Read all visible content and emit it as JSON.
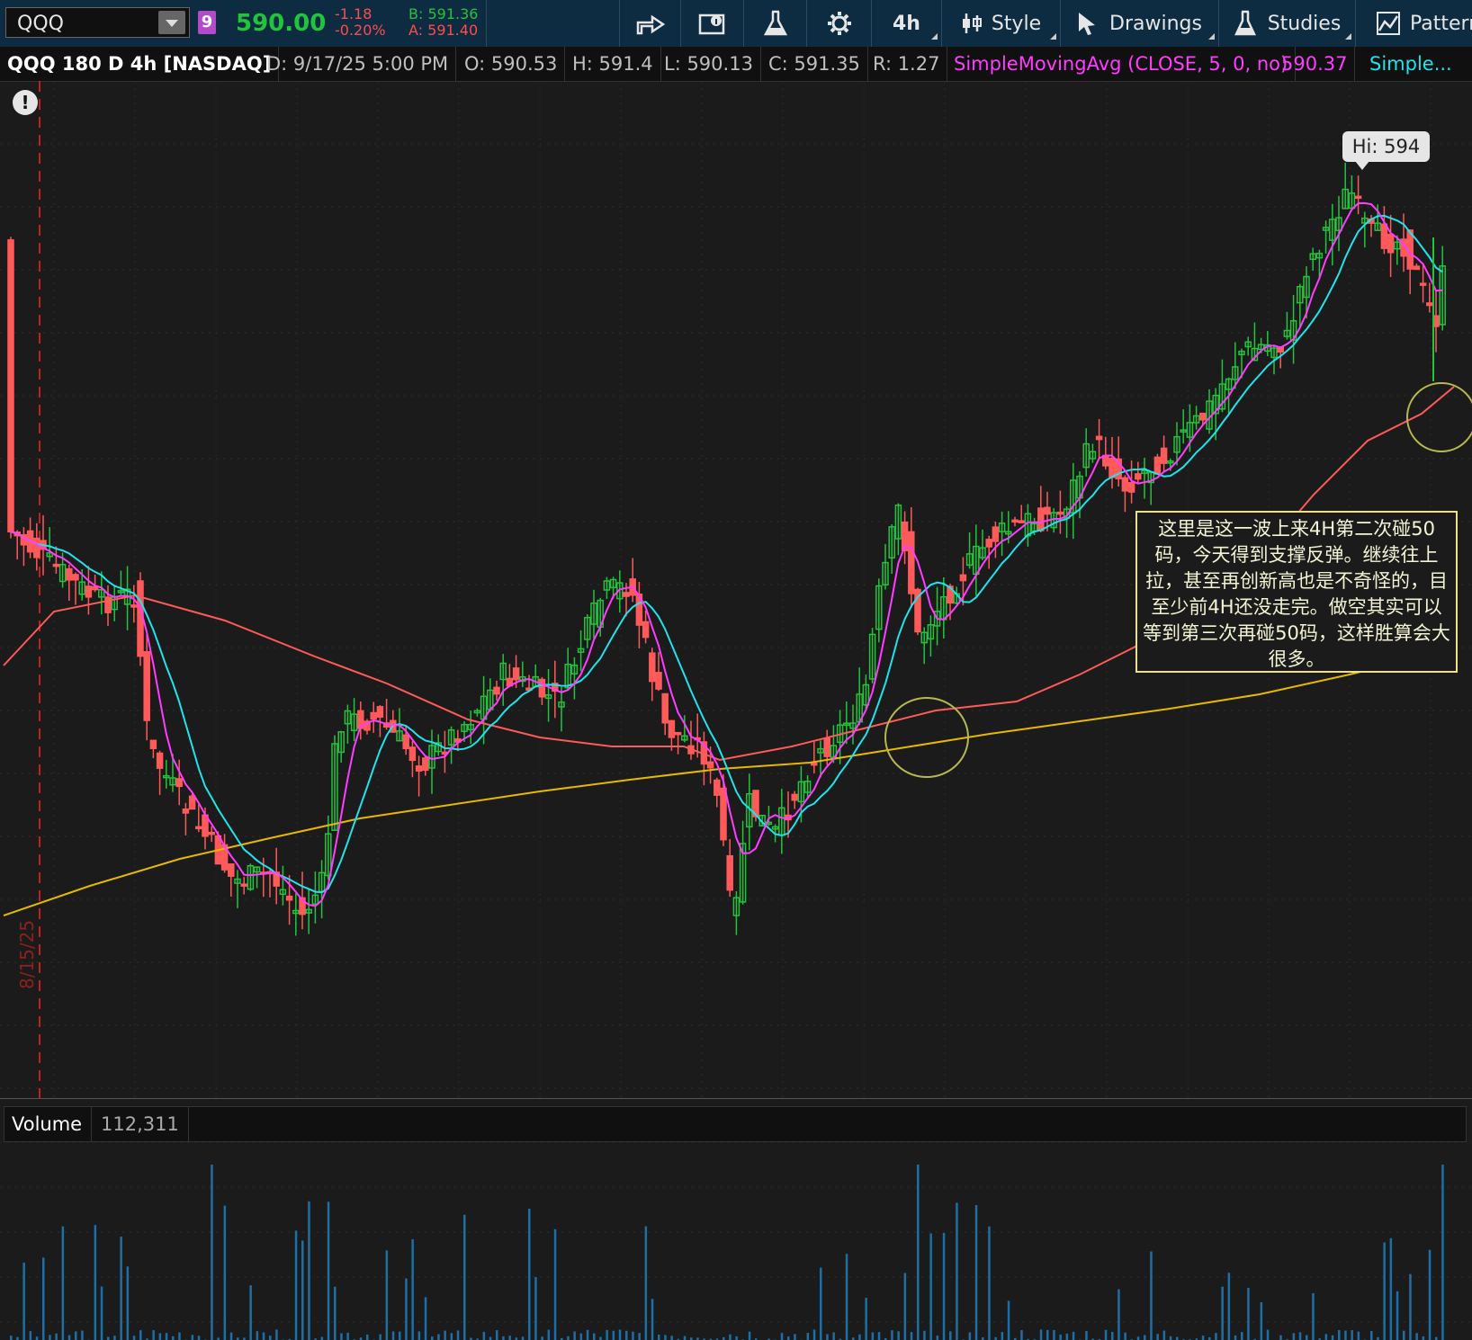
{
  "toolbar": {
    "symbol": "QQQ",
    "link_badge": "9",
    "last_price": "590.00",
    "net_change": "-1.18",
    "pct_change": "-0.20%",
    "bid": "B: 591.36",
    "ask": "A: 591.40",
    "aggregation": "4h",
    "style_label": "Style",
    "drawings_label": "Drawings",
    "studies_label": "Studies",
    "patterns_label": "Pattern",
    "icons": [
      "share-icon",
      "info-icon",
      "flask-icon",
      "gear-icon",
      "style-icon",
      "cursor-icon",
      "studies-icon",
      "pattern-icon"
    ]
  },
  "info_bar": {
    "title": "QQQ 180 D 4h [NASDAQ]",
    "date": "D: 9/17/25 5:00 PM",
    "open": "O: 590.53",
    "high": "H: 591.4",
    "low": "L: 590.13",
    "close": "C: 591.35",
    "range": "R: 1.27",
    "study": "SimpleMovingAvg (CLOSE, 5, 0, no)",
    "study_value": "590.37",
    "study2": "Simple..."
  },
  "chart": {
    "hi_bubble": "Hi: 594",
    "date_marker": "8/15/25",
    "annotation": "这里是这一波上来4H第二次碰50码，今天得到支撑反弹。继续往上拉，甚至再创新高也是不奇怪的，目至少前4H还没走完。做空其实可以等到第三次再碰50码，这样胜算会大很多。",
    "colors": {
      "up": "#22c43c",
      "down": "#ff5a5a",
      "sma5": "#ff3cff",
      "sma_cyan": "#20e3ec",
      "sma50": "#ff5a5a",
      "sma200": "#e6b800",
      "volume": "#1d6fa5"
    }
  },
  "volume_panel": {
    "label": "Volume",
    "value": "112,311"
  }
}
